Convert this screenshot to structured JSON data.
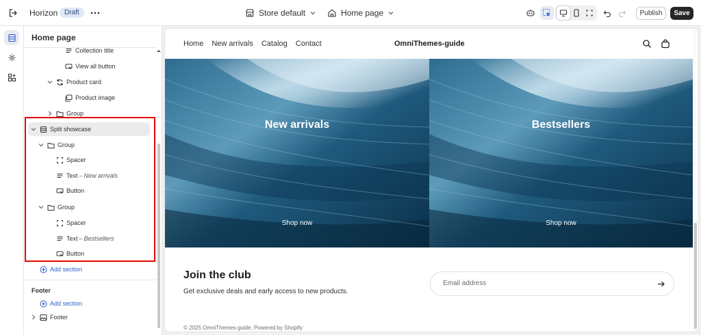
{
  "topbar": {
    "theme_name": "Horizon",
    "draft_badge": "Draft",
    "store_picker": "Store default",
    "page_picker": "Home page",
    "publish_label": "Publish",
    "save_label": "Save"
  },
  "sidebar": {
    "title": "Home page",
    "tree": [
      {
        "label": "Collection title",
        "icon": "text-lines-icon",
        "depth": 3
      },
      {
        "label": "View all button",
        "icon": "button-cursor-icon",
        "depth": 3
      },
      {
        "label": "Product card",
        "icon": "refresh-icon",
        "depth": 2,
        "expanded": true
      },
      {
        "label": "Product image",
        "icon": "image-stack-icon",
        "depth": 3
      },
      {
        "label": "Group",
        "icon": "folder-icon",
        "depth": 2,
        "expanded": false
      },
      {
        "label": "Split showcase",
        "icon": "section-icon",
        "depth": 0,
        "expanded": true,
        "selected": true
      },
      {
        "label": "Group",
        "icon": "folder-icon",
        "depth": 1,
        "expanded": true
      },
      {
        "label": "Spacer",
        "icon": "spacer-icon",
        "depth": 2
      },
      {
        "label": "Text",
        "detail": "New arrivals",
        "icon": "text-lines-icon",
        "depth": 2
      },
      {
        "label": "Button",
        "icon": "button-cursor-icon",
        "depth": 2
      },
      {
        "label": "Group",
        "icon": "folder-icon",
        "depth": 1,
        "expanded": true
      },
      {
        "label": "Spacer",
        "icon": "spacer-icon",
        "depth": 2
      },
      {
        "label": "Text",
        "detail": "Bestsellers",
        "icon": "text-lines-icon",
        "depth": 2
      },
      {
        "label": "Button",
        "icon": "button-cursor-icon",
        "depth": 2
      }
    ],
    "add_section": "Add section",
    "footer_label": "Footer",
    "footer_add_section": "Add section",
    "footer_item": "Footer"
  },
  "preview": {
    "nav": [
      "Home",
      "New arrivals",
      "Catalog",
      "Contact"
    ],
    "store_name": "OmniThemes-guide",
    "hero_left_title": "New arrivals",
    "hero_left_cta": "Shop now",
    "hero_right_title": "Bestsellers",
    "hero_right_cta": "Shop now",
    "join_title": "Join the club",
    "join_subtitle": "Get exclusive deals and early access to new products.",
    "email_placeholder": "Email address",
    "footer_text": "© 2025 OmniThemes-guide, Powered by Shopify"
  },
  "colors": {
    "accent": "#2c5cc5",
    "save_bg": "#262626",
    "highlight": "#e10600",
    "hero_dark": "#0d3a57",
    "hero_light": "#7fb4cf"
  }
}
